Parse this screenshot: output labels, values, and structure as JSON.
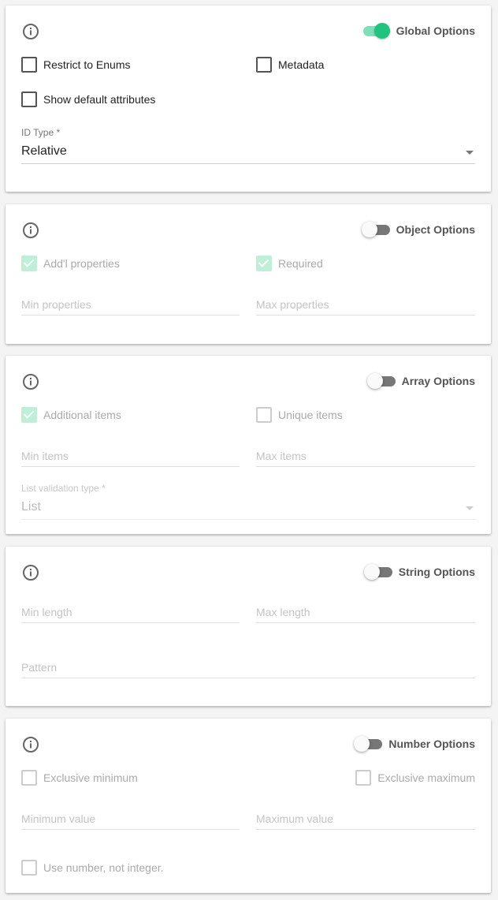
{
  "global": {
    "toggle_label": "Global Options",
    "toggle_on": true,
    "restrict_enums_label": "Restrict to Enums",
    "metadata_label": "Metadata",
    "show_default_label": "Show default attributes",
    "id_type_label": "ID Type *",
    "id_type_value": "Relative"
  },
  "object": {
    "toggle_label": "Object Options",
    "toggle_on": false,
    "addl_label": "Add'l properties",
    "required_label": "Required",
    "min_props_placeholder": "Min properties",
    "max_props_placeholder": "Max properties"
  },
  "array": {
    "toggle_label": "Array Options",
    "toggle_on": false,
    "additional_items_label": "Additional items",
    "unique_items_label": "Unique items",
    "min_items_placeholder": "Min items",
    "max_items_placeholder": "Max items",
    "list_validation_label": "List validation type *",
    "list_validation_value": "List"
  },
  "string": {
    "toggle_label": "String Options",
    "toggle_on": false,
    "min_length_placeholder": "Min length",
    "max_length_placeholder": "Max length",
    "pattern_placeholder": "Pattern"
  },
  "number": {
    "toggle_label": "Number Options",
    "toggle_on": false,
    "excl_min_label": "Exclusive minimum",
    "excl_max_label": "Exclusive maximum",
    "min_value_placeholder": "Minimum value",
    "max_value_placeholder": "Maximum value",
    "use_number_label": "Use number, not integer."
  },
  "colors": {
    "accent": "#21c47f",
    "accent_light": "#7fe0b7",
    "disabled_check": "#bfeed9"
  }
}
